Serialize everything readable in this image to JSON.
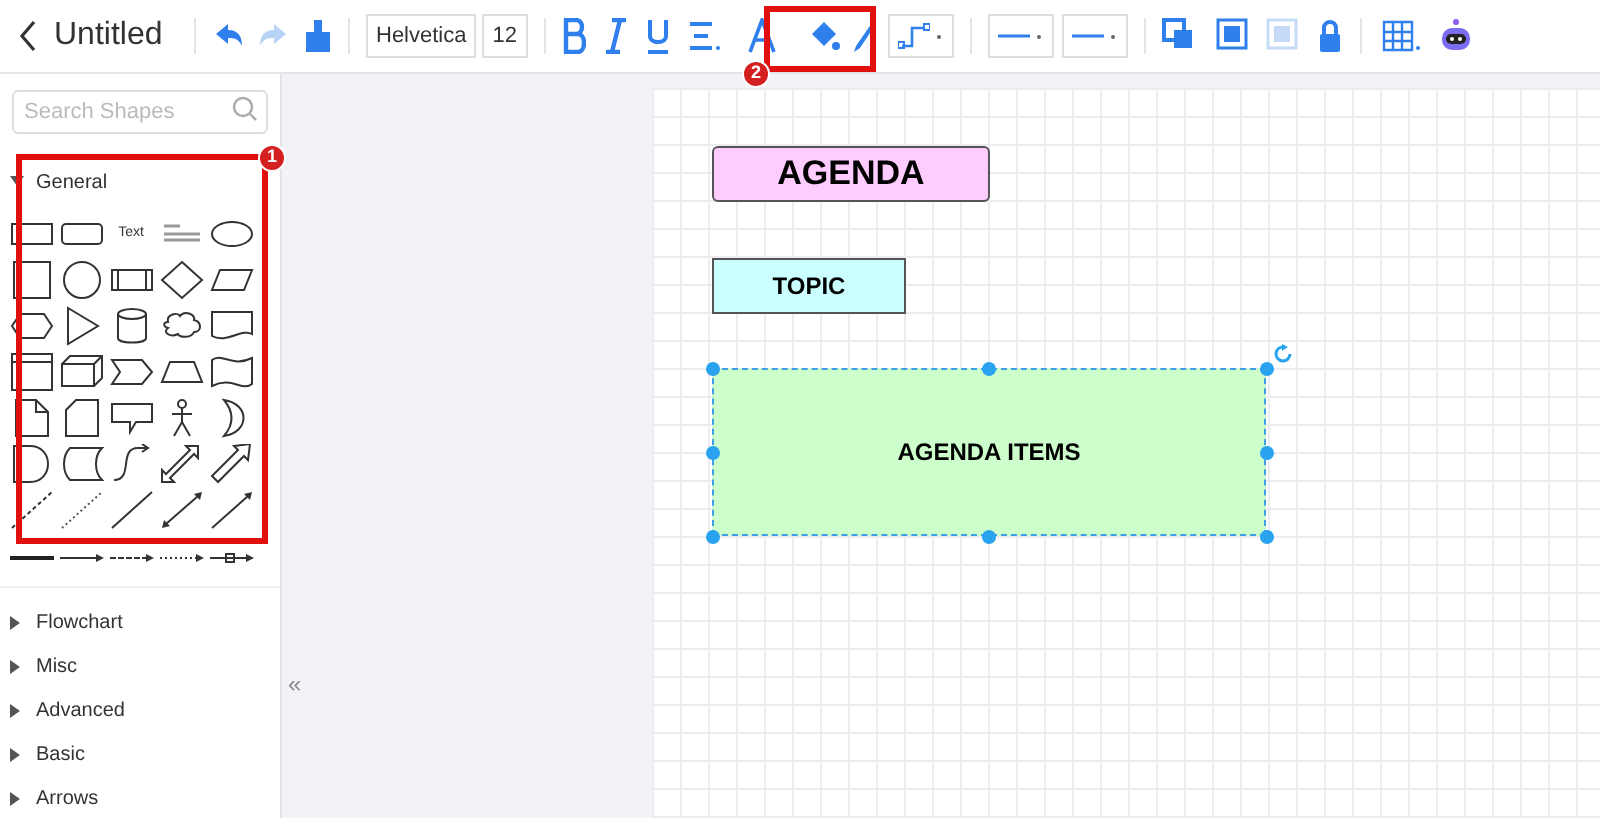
{
  "toolbar": {
    "title": "Untitled",
    "font": "Helvetica",
    "font_size": "12"
  },
  "sidebar": {
    "search": {
      "placeholder": "Search Shapes"
    },
    "general": {
      "label": "General",
      "expanded": true,
      "shapes": [
        {
          "kind": "rect"
        },
        {
          "kind": "rounded"
        },
        {
          "kind": "text",
          "text": "Text"
        },
        {
          "kind": "heading"
        },
        {
          "kind": "ellipse"
        },
        {
          "kind": "square"
        },
        {
          "kind": "circle"
        },
        {
          "kind": "process"
        },
        {
          "kind": "diamond"
        },
        {
          "kind": "parallelogram"
        },
        {
          "kind": "hexagon"
        },
        {
          "kind": "triangle"
        },
        {
          "kind": "cylinder"
        },
        {
          "kind": "cloud"
        },
        {
          "kind": "document"
        },
        {
          "kind": "internal"
        },
        {
          "kind": "cube"
        },
        {
          "kind": "step"
        },
        {
          "kind": "trapezoid"
        },
        {
          "kind": "tape"
        },
        {
          "kind": "note"
        },
        {
          "kind": "card"
        },
        {
          "kind": "callout"
        },
        {
          "kind": "actor"
        },
        {
          "kind": "or"
        },
        {
          "kind": "delay"
        },
        {
          "kind": "data"
        },
        {
          "kind": "curve"
        },
        {
          "kind": "double-arrow"
        },
        {
          "kind": "arrow"
        },
        {
          "kind": "dashed-line"
        },
        {
          "kind": "dotted-line"
        },
        {
          "kind": "line"
        },
        {
          "kind": "bi-line"
        },
        {
          "kind": "arrow-line"
        }
      ],
      "connectors": [
        {
          "kind": "thick"
        },
        {
          "kind": "thin-arrow"
        },
        {
          "kind": "dash-arrow"
        },
        {
          "kind": "dot-arrow"
        },
        {
          "kind": "box-arrow"
        }
      ]
    },
    "categories": [
      {
        "label": "Flowchart",
        "expanded": false
      },
      {
        "label": "Misc",
        "expanded": false
      },
      {
        "label": "Advanced",
        "expanded": false
      },
      {
        "label": "Basic",
        "expanded": false
      },
      {
        "label": "Arrows",
        "expanded": false
      }
    ],
    "collapse": "«"
  },
  "annotations": [
    {
      "label": "1"
    },
    {
      "label": "2"
    }
  ],
  "diagram": {
    "nodes": [
      {
        "text": "AGENDA",
        "color": "#ffccff",
        "selected": false
      },
      {
        "text": "TOPIC",
        "color": "#ccffff",
        "selected": false
      },
      {
        "text": "AGENDA ITEMS",
        "color": "#ccffcc",
        "selected": true
      }
    ]
  }
}
